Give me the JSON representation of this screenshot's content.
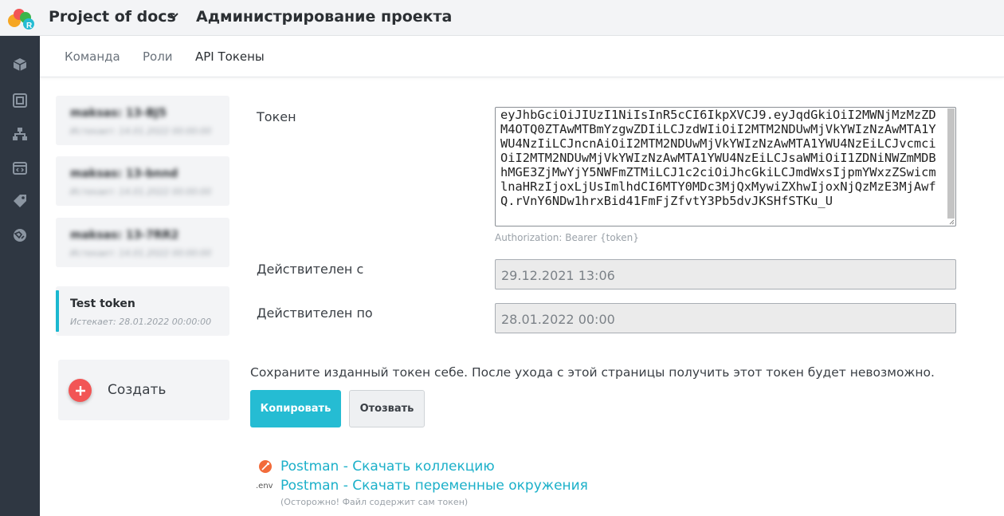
{
  "header": {
    "project_title": "Project of docs",
    "page_title": "Администрирование проекта"
  },
  "subnav": {
    "tabs": [
      {
        "label": "Команда"
      },
      {
        "label": "Роли"
      },
      {
        "label": "API Токены"
      }
    ],
    "active_tab": "API Токены"
  },
  "sidebar": {
    "icons": [
      "cube-icon",
      "frame-icon",
      "hierarchy-icon",
      "code-window-icon",
      "tag-icon",
      "settings-globe-icon"
    ]
  },
  "tokens": [
    {
      "name": "maksas: 13-BJ5",
      "expires": "Истекает: 14.01.2022 00:00:00"
    },
    {
      "name": "maksas: 13-bnnd",
      "expires": "Истекает: 14.01.2022 00:00:00"
    },
    {
      "name": "maksas: 13-7RR2",
      "expires": "Истекает: 14.01.2022 00:00:00"
    },
    {
      "name": "Test token",
      "expires": "Истекает: 28.01.2022 00:00:00"
    }
  ],
  "create_label": "Создать",
  "form": {
    "token_label": "Токен",
    "token_value": "eyJhbGciOiJIUzI1NiIsInR5cCI6IkpXVCJ9.eyJqdGkiOiI2MWNjMzMzZDM4OTQ0ZTAwMTBmYzgwZDIiLCJzdWIiOiI2MTM2NDUwMjVkYWIzNzAwMTA1YWU4NzIiLCJncnAiOiI2MTM2NDUwMjVkYWIzNzAwMTA1YWU4NzEiLCJvcmciOiI2MTM2NDUwMjVkYWIzNzAwMTA1YWU4NzEiLCJsaWMiOiI1ZDNiNWZmMDBhMGE3ZjMwYjY5NWFmZTMiLCJ1c2ciOiJhcGkiLCJmdWxsIjpmYWxzZSwicmlnaHRzIjoxLjUsImlhdCI6MTY0MDc3MjQxMywiZXhwIjoxNjQzMzE3MjAwfQ.rVnY6NDw1hrxBid41FmFjZfvtY3Pb5dvJKSHfSTKu_U",
    "token_hint": "Authorization: Bearer {token}",
    "valid_from_label": "Действителен с",
    "valid_from_value": "29.12.2021 13:06",
    "valid_to_label": "Действителен по",
    "valid_to_value": "28.01.2022 00:00"
  },
  "warning": "Сохраните изданный токен себе. После ухода с этой страницы получить этот токен будет невозможно.",
  "buttons": {
    "copy": "Копировать",
    "revoke": "Отозвать"
  },
  "links": {
    "postman_collection": "Postman - Скачать коллекцию",
    "postman_env": "Postman - Скачать переменные окружения",
    "env_icon_text": ".env",
    "env_note": "(Осторожно! Файл содержит сам токен)"
  },
  "colors": {
    "accent": "#25bcd3",
    "link": "#1bb0c9",
    "create_plus": "#f25555",
    "sidebar_bg": "#2f3742"
  }
}
